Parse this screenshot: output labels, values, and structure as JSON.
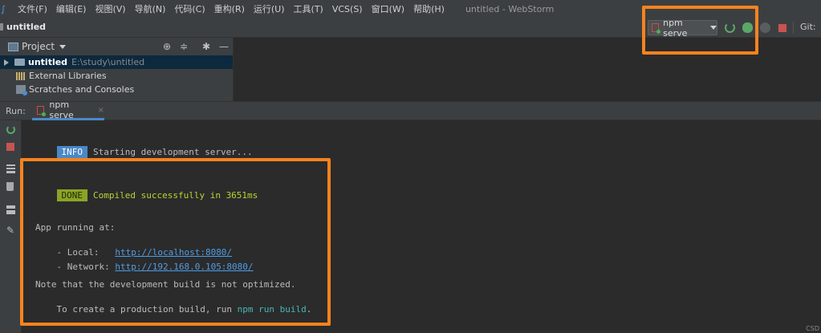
{
  "menubar": {
    "items": [
      "文件(F)",
      "编辑(E)",
      "视图(V)",
      "导航(N)",
      "代码(C)",
      "重构(R)",
      "运行(U)",
      "工具(T)",
      "VCS(S)",
      "窗口(W)",
      "帮助(H)"
    ],
    "window_title": "untitled - WebStorm"
  },
  "navbar": {
    "project_crumb": "untitled",
    "run_config": "npm serve",
    "git_label": "Git:"
  },
  "project_panel": {
    "title": "Project",
    "tree": [
      {
        "name": "untitled",
        "path": "E:\\study\\untitled"
      },
      {
        "name": "External Libraries"
      },
      {
        "name": "Scratches and Consoles"
      }
    ]
  },
  "run_panel": {
    "label": "Run:",
    "tab_label": "npm serve",
    "tab_close": "×"
  },
  "console": {
    "info_badge": "INFO",
    "info_text": "Starting development server...",
    "done_badge": "DONE",
    "done_text": "Compiled successfully in 3651ms",
    "app_running": "App running at:",
    "local_label": "- Local:   ",
    "local_url": "http://localhost:8080/",
    "network_label": "- Network: ",
    "network_url": "http://192.168.0.105:8080/",
    "note_line": "Note that the development build is not optimized.",
    "prod_prefix": "To create a production build, run ",
    "prod_cmd": "npm run build",
    "prod_suffix": "."
  },
  "colors": {
    "highlight": "#f7831e",
    "info_badge": "#4a88c7",
    "done_badge": "#8ba427",
    "link": "#4f9de6"
  },
  "watermark": "CSD"
}
